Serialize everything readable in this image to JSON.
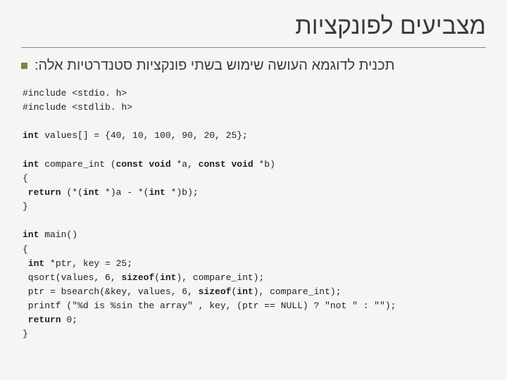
{
  "title": "מצביעים לפונקציות",
  "subtitle": "תכנית לדוגמא העושה שימוש בשתי פונקציות סטנדרטיות אלה:",
  "code": {
    "l01": "#include <stdio. h>",
    "l02": "#include <stdlib. h>",
    "l03": "",
    "l04a": "int",
    "l04b": " values[] = {40, 10, 100, 90, 20, 25};",
    "l05": "",
    "l06a": "int",
    "l06b": " compare_int (",
    "l06c": "const void",
    "l06d": " *a, ",
    "l06e": "const void",
    "l06f": " *b)",
    "l07": "{",
    "l08a": " return",
    "l08b": " (*(",
    "l08c": "int",
    "l08d": " *)a - *(",
    "l08e": "int",
    "l08f": " *)b);",
    "l09": "}",
    "l10": "",
    "l11a": "int",
    "l11b": " main()",
    "l12": "{",
    "l13a": " int",
    "l13b": " *ptr, key = 25;",
    "l14a": " qsort(values, 6, ",
    "l14b": "sizeof",
    "l14c": "(",
    "l14d": "int",
    "l14e": "), compare_int);",
    "l15a": " ptr = bsearch(&key, values, 6, ",
    "l15b": "sizeof",
    "l15c": "(",
    "l15d": "int",
    "l15e": "), compare_int);",
    "l16": " printf (\"%d is %sin the array\" , key, (ptr == NULL) ? \"not \" : \"\");",
    "l17a": " return",
    "l17b": " 0;",
    "l18": "}"
  }
}
